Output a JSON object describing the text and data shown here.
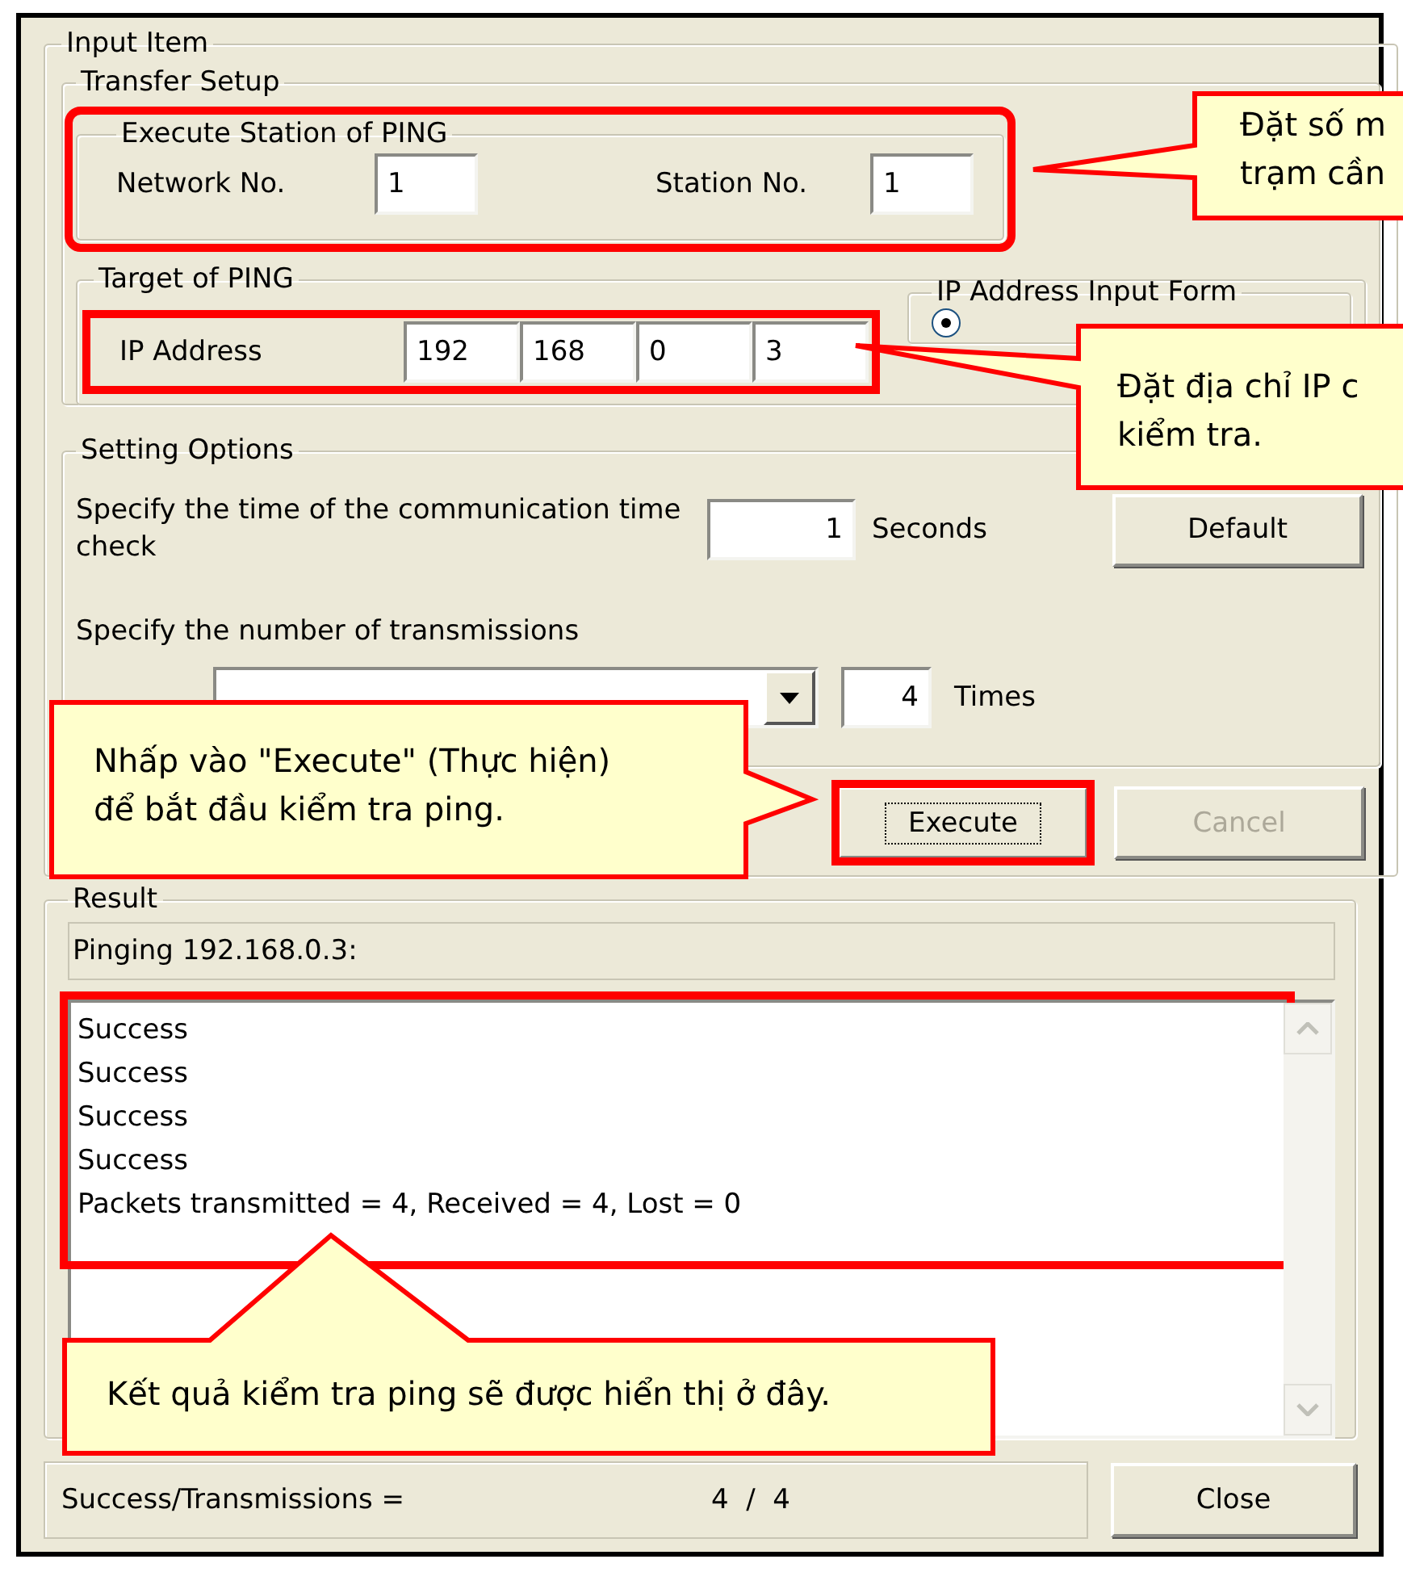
{
  "dialog": {
    "input_item": {
      "title": "Input Item",
      "transfer_setup": {
        "title": "Transfer Setup",
        "execute_station": {
          "title": "Execute Station of PING",
          "highlighted": true,
          "network_label": "Network No.",
          "network_value": "1",
          "station_label": "Station No.",
          "station_value": "1"
        },
        "target": {
          "title": "Target of PING",
          "ip_label": "IP Address",
          "highlighted": true,
          "ip_octets": [
            "192",
            "168",
            "0",
            "3"
          ],
          "input_form": {
            "title": "IP Address Input Form",
            "options": [
              {
                "selected": true
              }
            ]
          }
        }
      },
      "setting_options": {
        "title": "Setting Options",
        "time_label": "Specify the time of the communication time check",
        "time_value": "1",
        "time_unit": "Seconds",
        "default_button": "Default",
        "count_label": "Specify the number of transmissions",
        "count_value": "4",
        "count_unit": "Times"
      },
      "execute_button": {
        "label": "Execute",
        "highlighted": true
      },
      "cancel_button": {
        "label": "Cancel",
        "disabled": true
      }
    },
    "result": {
      "title": "Result",
      "pinging": "Pinging 192.168.0.3:",
      "highlighted": true,
      "lines": [
        "Success",
        "Success",
        "Success",
        "Success",
        "Packets transmitted = 4, Received = 4, Lost = 0"
      ]
    },
    "status": {
      "label": "Success/Transmissions =",
      "value": "4  /  4"
    },
    "close_button": "Close"
  },
  "callouts": [
    {
      "lines": [
        "Đặt số m",
        "trạm cần"
      ]
    },
    {
      "lines": [
        "Đặt địa chỉ IP c",
        "kiểm tra."
      ]
    },
    {
      "lines": [
        "Nhấp vào \"Execute\" (Thực hiện)",
        "để bắt đầu kiểm tra ping."
      ]
    },
    {
      "lines": [
        "Kết quả kiểm tra ping sẽ được hiển thị ở đây."
      ]
    }
  ]
}
